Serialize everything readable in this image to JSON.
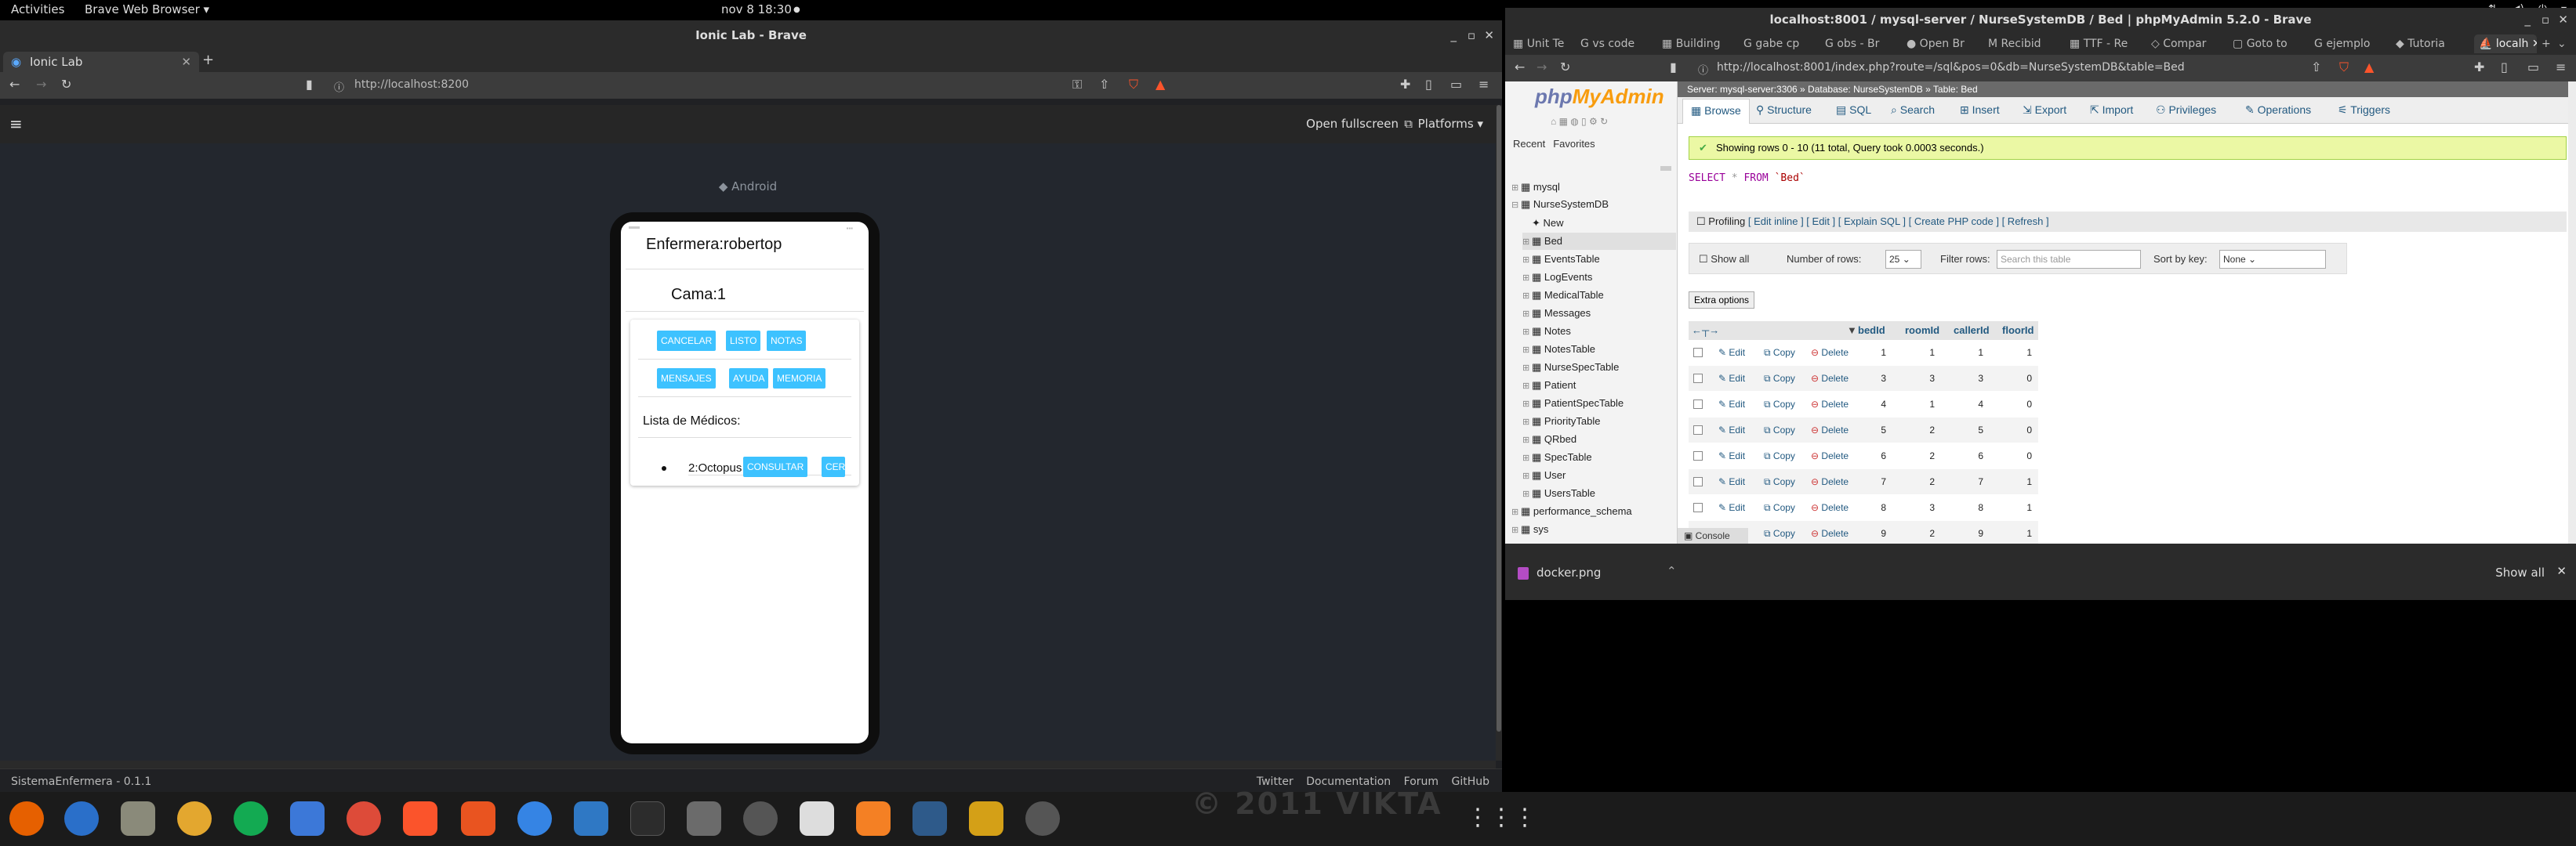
{
  "topbar": {
    "activities": "Activities",
    "app": "Brave Web Browser ▾",
    "clock": "nov 8  18:30",
    "dot": "●"
  },
  "left_window": {
    "title": "Ionic Lab - Brave",
    "tab_label": "Ionic Lab",
    "url": "http://localhost:8200",
    "ionic": {
      "open_fullscreen": "Open fullscreen",
      "platforms": "Platforms ▾",
      "android": "Android",
      "screen_title": "Enfermera:robertop",
      "cama": "Cama:1",
      "buttons_row1": [
        "CANCELAR",
        "LISTO",
        "NOTAS"
      ],
      "buttons_row2": [
        "MENSAJES",
        "AYUDA",
        "MEMORIA"
      ],
      "lista": "Lista de Médicos:",
      "doctor": "2:Octopus",
      "consultar": "CONSULTAR",
      "cerrar": "CER"
    },
    "footer": {
      "app": "SistemaEnfermera - 0.1.1",
      "links": [
        "Twitter",
        "Documentation",
        "Forum",
        "GitHub"
      ]
    }
  },
  "right_window": {
    "title": "localhost:8001 / mysql-server / NurseSystemDB / Bed | phpMyAdmin 5.2.0 - Brave",
    "tabs": [
      "Unit Te",
      "vs code",
      "Building",
      "gabe cp",
      "obs - Br",
      "Open Br",
      "Recibid",
      "TTF - Re",
      "Compar",
      "Goto to",
      "ejemplo",
      "Tutoria",
      "localh"
    ],
    "url": "http://localhost:8001/index.php?route=/sql&pos=0&db=NurseSystemDB&table=Bed",
    "pma": {
      "logo_php": "php",
      "logo_my": "MyAdmin",
      "recent": "Recent",
      "favorites": "Favorites",
      "tree": [
        "mysql",
        "NurseSystemDB",
        "New",
        "Bed",
        "EventsTable",
        "LogEvents",
        "MedicalTable",
        "Messages",
        "Notes",
        "NotesTable",
        "NurseSpecTable",
        "Patient",
        "PatientSpecTable",
        "PriorityTable",
        "QRbed",
        "SpecTable",
        "User",
        "UsersTable",
        "performance_schema",
        "sys"
      ],
      "breadcrumb": "Server: mysql-server:3306 » Database: NurseSystemDB » Table: Bed",
      "navtabs": [
        "Browse",
        "Structure",
        "SQL",
        "Search",
        "Insert",
        "Export",
        "Import",
        "Privileges",
        "Operations",
        "Triggers"
      ],
      "success": "Showing rows 0 - 10 (11 total, Query took 0.0003 seconds.)",
      "sql_select": "SELECT",
      "sql_star": "*",
      "sql_from": "FROM",
      "sql_table": "`Bed`",
      "profiling": "Profiling",
      "profiling_links": "[ Edit inline ] [ Edit ] [ Explain SQL ] [ Create PHP code ] [ Refresh ]",
      "show_all": "Show all",
      "num_rows_label": "Number of rows:",
      "num_rows": "25",
      "filter_label": "Filter rows:",
      "filter_placeholder": "Search this table",
      "sort_label": "Sort by key:",
      "sort_value": "None",
      "extra": "Extra options",
      "columns": [
        "bedId",
        "roomId",
        "callerId",
        "floorId"
      ],
      "rows": [
        [
          1,
          1,
          1,
          1
        ],
        [
          3,
          3,
          3,
          0
        ],
        [
          4,
          1,
          4,
          0
        ],
        [
          5,
          2,
          5,
          0
        ],
        [
          6,
          2,
          6,
          0
        ],
        [
          7,
          2,
          7,
          1
        ],
        [
          8,
          3,
          8,
          1
        ],
        [
          9,
          2,
          9,
          1
        ]
      ],
      "edit": "Edit",
      "copy": "Copy",
      "delete": "Delete",
      "console": "Console"
    },
    "download": {
      "file": "docker.png",
      "show_all": "Show all"
    }
  },
  "watermark": "© 2011 VIKTA"
}
